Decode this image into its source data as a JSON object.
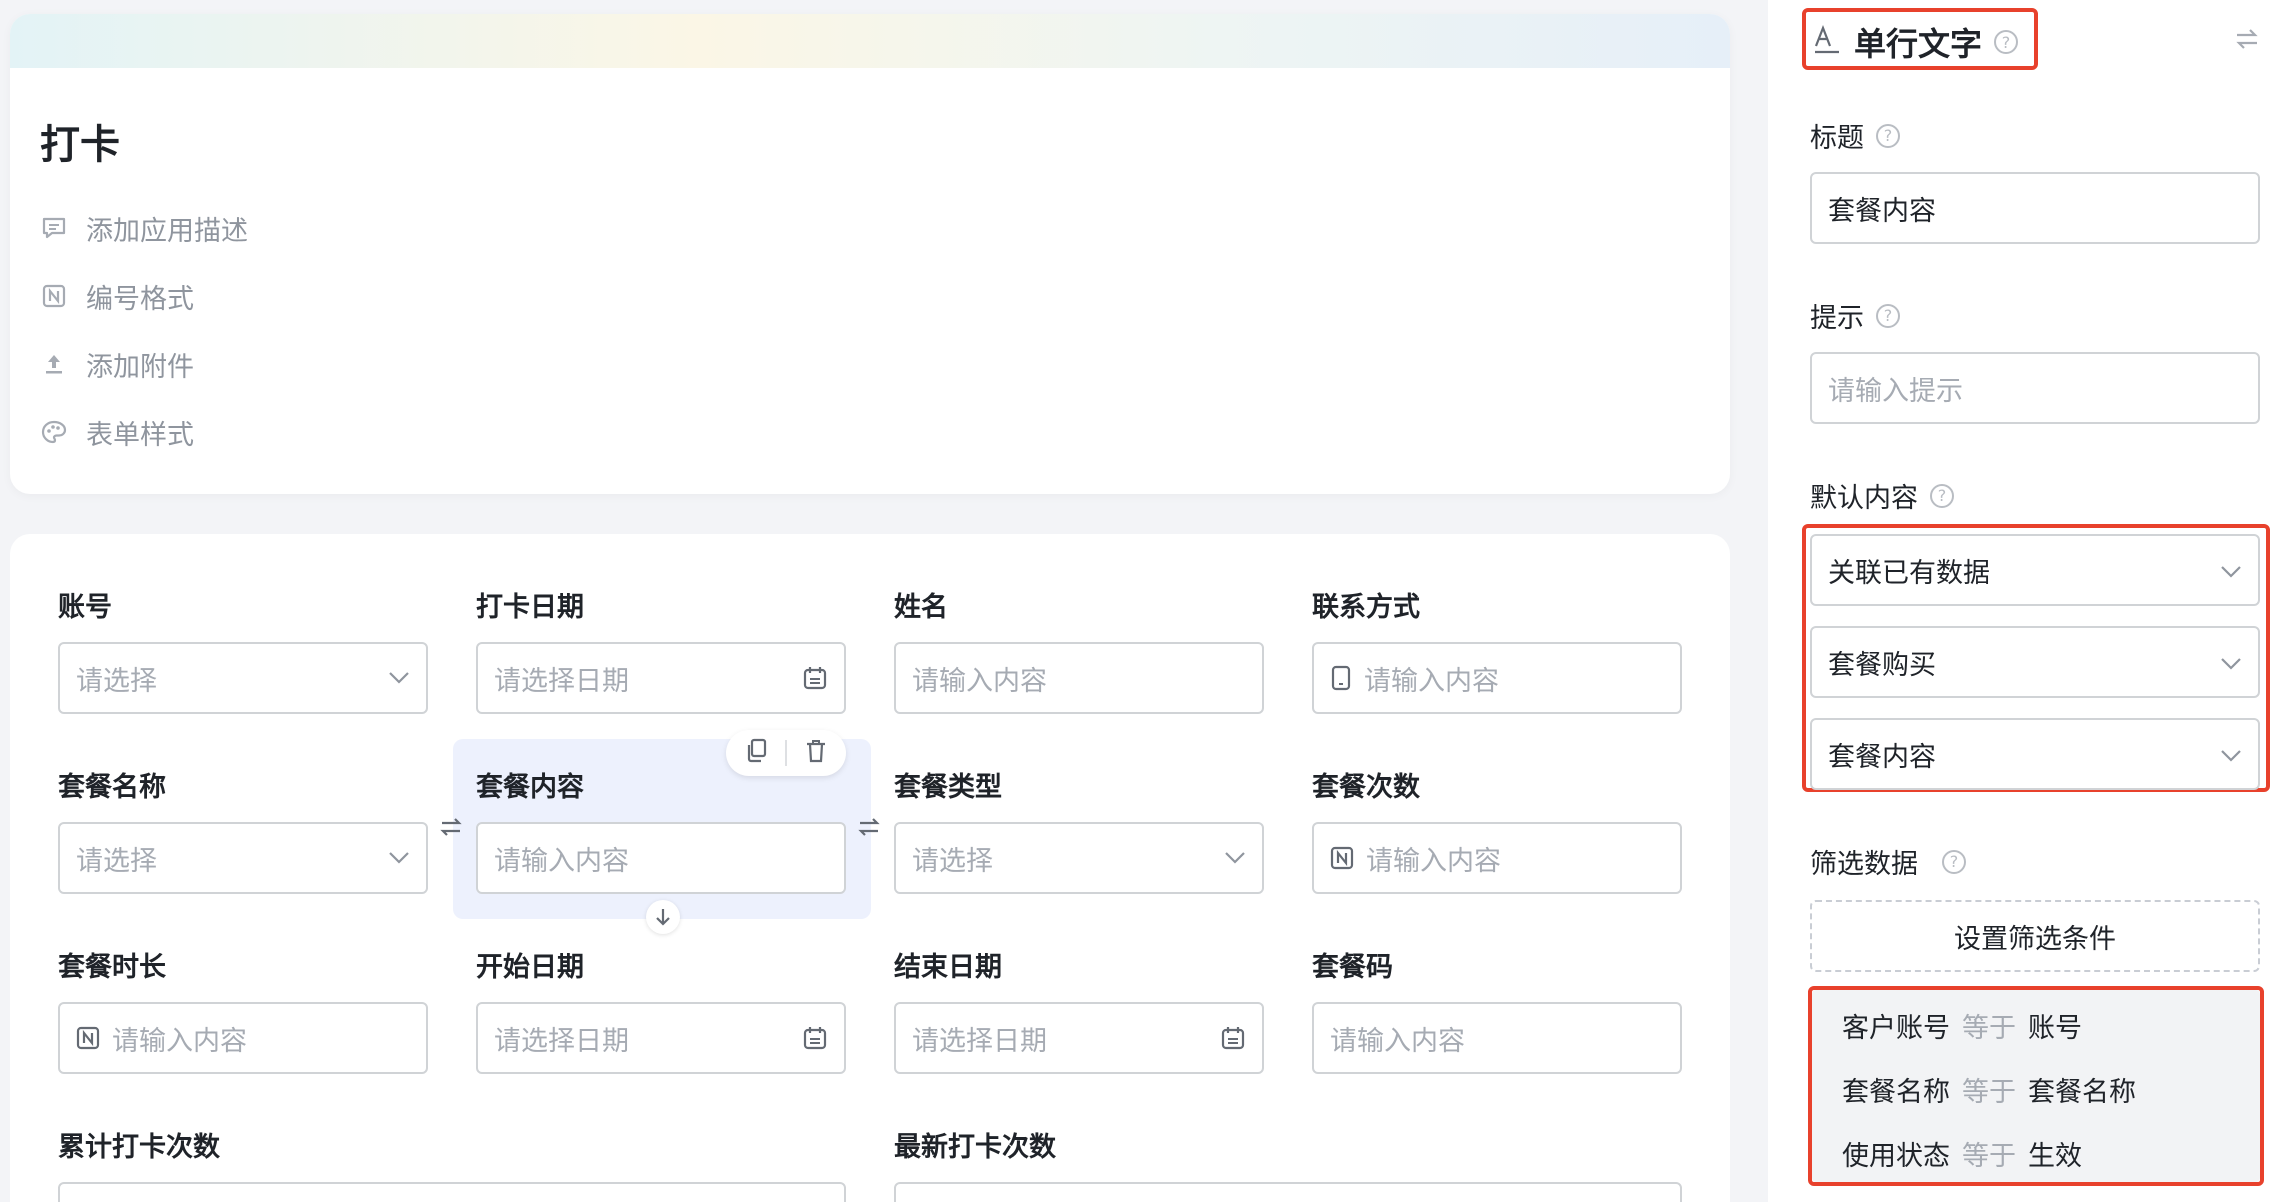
{
  "app": {
    "title": "打卡",
    "meta": [
      {
        "icon": "comment-icon",
        "label": "添加应用描述"
      },
      {
        "icon": "number-format-icon",
        "label": "编号格式"
      },
      {
        "icon": "upload-icon",
        "label": "添加附件"
      },
      {
        "icon": "palette-icon",
        "label": "表单样式"
      }
    ]
  },
  "form": {
    "fields": [
      {
        "label": "账号",
        "placeholder": "请选择",
        "type": "select"
      },
      {
        "label": "打卡日期",
        "placeholder": "请选择日期",
        "type": "date"
      },
      {
        "label": "姓名",
        "placeholder": "请输入内容",
        "type": "text"
      },
      {
        "label": "联系方式",
        "placeholder": "请输入内容",
        "type": "phone"
      },
      {
        "label": "套餐名称",
        "placeholder": "请选择",
        "type": "select"
      },
      {
        "label": "套餐内容",
        "placeholder": "请输入内容",
        "type": "text",
        "selected": true
      },
      {
        "label": "套餐类型",
        "placeholder": "请选择",
        "type": "select"
      },
      {
        "label": "套餐次数",
        "placeholder": "请输入内容",
        "type": "number"
      },
      {
        "label": "套餐时长",
        "placeholder": "请输入内容",
        "type": "number"
      },
      {
        "label": "开始日期",
        "placeholder": "请选择日期",
        "type": "date"
      },
      {
        "label": "结束日期",
        "placeholder": "请选择日期",
        "type": "date"
      },
      {
        "label": "套餐码",
        "placeholder": "请输入内容",
        "type": "text"
      },
      {
        "label": "累计打卡次数",
        "placeholder": "",
        "type": "text"
      },
      {
        "label": "最新打卡次数",
        "placeholder": "",
        "type": "text"
      }
    ]
  },
  "panel": {
    "title": "单行文字",
    "title_label": "标题",
    "title_value": "套餐内容",
    "hint_label": "提示",
    "hint_placeholder": "请输入提示",
    "default_label": "默认内容",
    "default_selects": [
      "关联已有数据",
      "套餐购买",
      "套餐内容"
    ],
    "filter_label": "筛选数据",
    "filter_button": "设置筛选条件",
    "conditions": [
      {
        "field": "客户账号",
        "op": "等于",
        "value": "账号"
      },
      {
        "field": "套餐名称",
        "op": "等于",
        "value": "套餐名称"
      },
      {
        "field": "使用状态",
        "op": "等于",
        "value": "生效"
      }
    ]
  },
  "colors": {
    "accent_red": "#e8412c",
    "selected_bg": "#edf1fd",
    "placeholder": "#a6abb3"
  }
}
